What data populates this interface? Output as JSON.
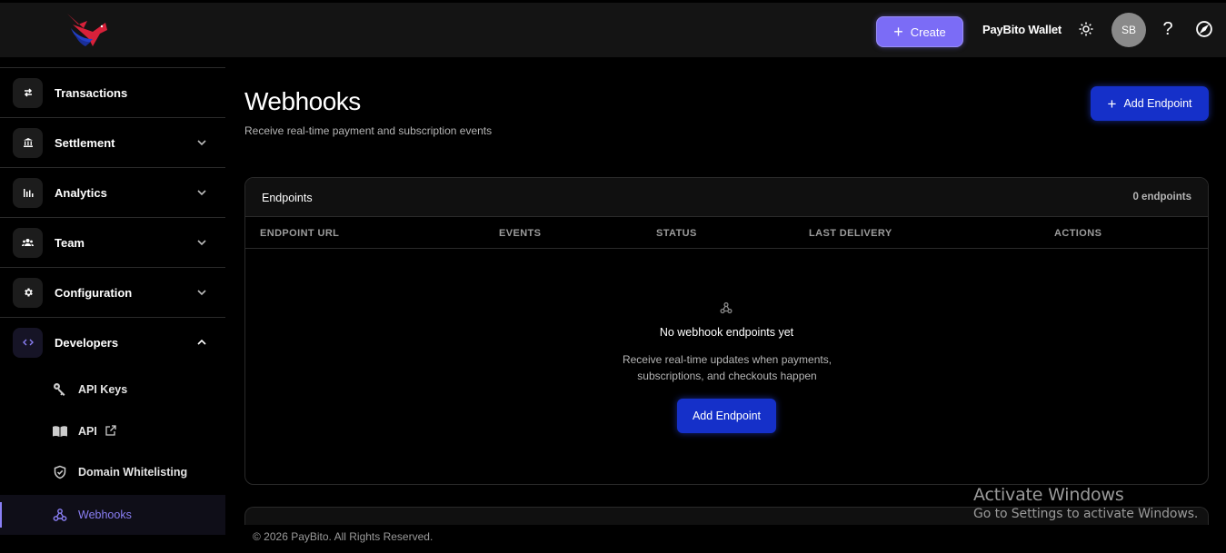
{
  "topbar": {
    "create_label": "Create",
    "wallet_label": "PayBito Wallet",
    "avatar_initials": "SB",
    "help_glyph": "?"
  },
  "sidebar": {
    "items": [
      {
        "label": "Transactions",
        "icon": "arrows-swap-icon"
      },
      {
        "label": "Settlement",
        "icon": "bank-icon"
      },
      {
        "label": "Analytics",
        "icon": "bar-chart-icon"
      },
      {
        "label": "Team",
        "icon": "team-icon"
      },
      {
        "label": "Configuration",
        "icon": "gear-icon"
      },
      {
        "label": "Developers",
        "icon": "code-icon"
      }
    ],
    "sub_items": [
      {
        "label": "API Keys",
        "icon": "key-icon"
      },
      {
        "label": "API",
        "icon": "book-icon"
      },
      {
        "label": "Domain Whitelisting",
        "icon": "shield-check-icon"
      },
      {
        "label": "Webhooks",
        "icon": "webhook-icon"
      }
    ]
  },
  "main": {
    "title": "Webhooks",
    "subtitle": "Receive real-time payment and subscription events",
    "add_endpoint_label": "Add Endpoint",
    "card": {
      "title": "Endpoints",
      "count": "0 endpoints",
      "columns": [
        "ENDPOINT URL",
        "EVENTS",
        "STATUS",
        "LAST DELIVERY",
        "ACTIONS"
      ],
      "empty_title": "No webhook endpoints yet",
      "empty_desc_line1": "Receive real-time updates when payments,",
      "empty_desc_line2": "subscriptions, and checkouts happen",
      "empty_button_label": "Add Endpoint"
    }
  },
  "footer": {
    "copyright": "© 2026 PayBito. All Rights Reserved."
  },
  "watermark": {
    "line1": "Activate Windows",
    "line2": "Go to Settings to activate Windows."
  },
  "colors": {
    "accent_purple": "#7b6cf6",
    "primary_blue": "#1530c9",
    "active_text": "#8a7ff5"
  }
}
